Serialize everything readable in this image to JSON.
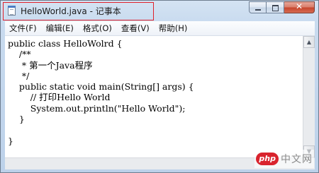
{
  "window": {
    "title": "HelloWorld.java - 记事本",
    "icon": "notepad-icon",
    "highlight_color": "#e0202a"
  },
  "caption_buttons": {
    "minimize": "minimize-icon",
    "maximize": "maximize-icon",
    "close": "✕"
  },
  "menubar": {
    "items": [
      {
        "label": "文件(F)"
      },
      {
        "label": "编辑(E)"
      },
      {
        "label": "格式(O)"
      },
      {
        "label": "查看(V)"
      },
      {
        "label": "帮助(H)"
      }
    ]
  },
  "editor": {
    "content": "public class HelloWolrd {\n    /**\n     * 第一个Java程序\n     */\n    public static void main(String[] args) {\n        // 打印Hello World\n        System.out.println(\"Hello World\");\n    }\n\n}"
  },
  "scrollbar": {
    "up": "▲",
    "down": "▼"
  },
  "watermark": {
    "badge": "php",
    "text": "中文网"
  }
}
